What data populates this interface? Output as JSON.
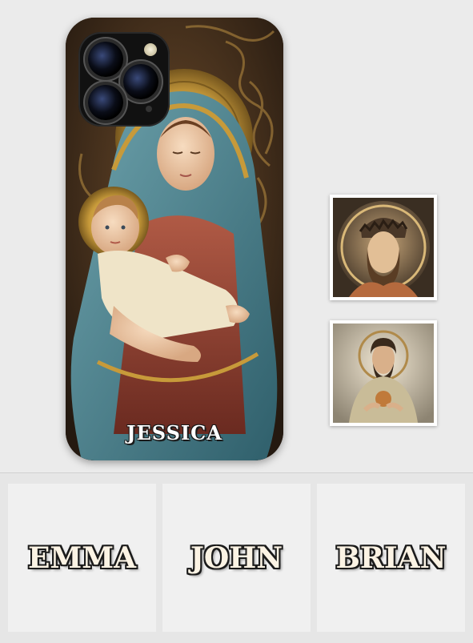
{
  "product": {
    "case_name": "JESSICA"
  },
  "thumbnails": [
    {
      "subject": "crowned-christ-relief"
    },
    {
      "subject": "sacred-heart-christ"
    }
  ],
  "name_examples": [
    {
      "name": "EMMA"
    },
    {
      "name": "JOHN"
    },
    {
      "name": "BRIAN"
    }
  ],
  "colors": {
    "background": "#e6e6e6",
    "veil_blue": "#3f7a86",
    "halo_gold": "#c79a3a",
    "robe_red": "#8a3a2e",
    "carving_brown": "#3b2a1a"
  }
}
